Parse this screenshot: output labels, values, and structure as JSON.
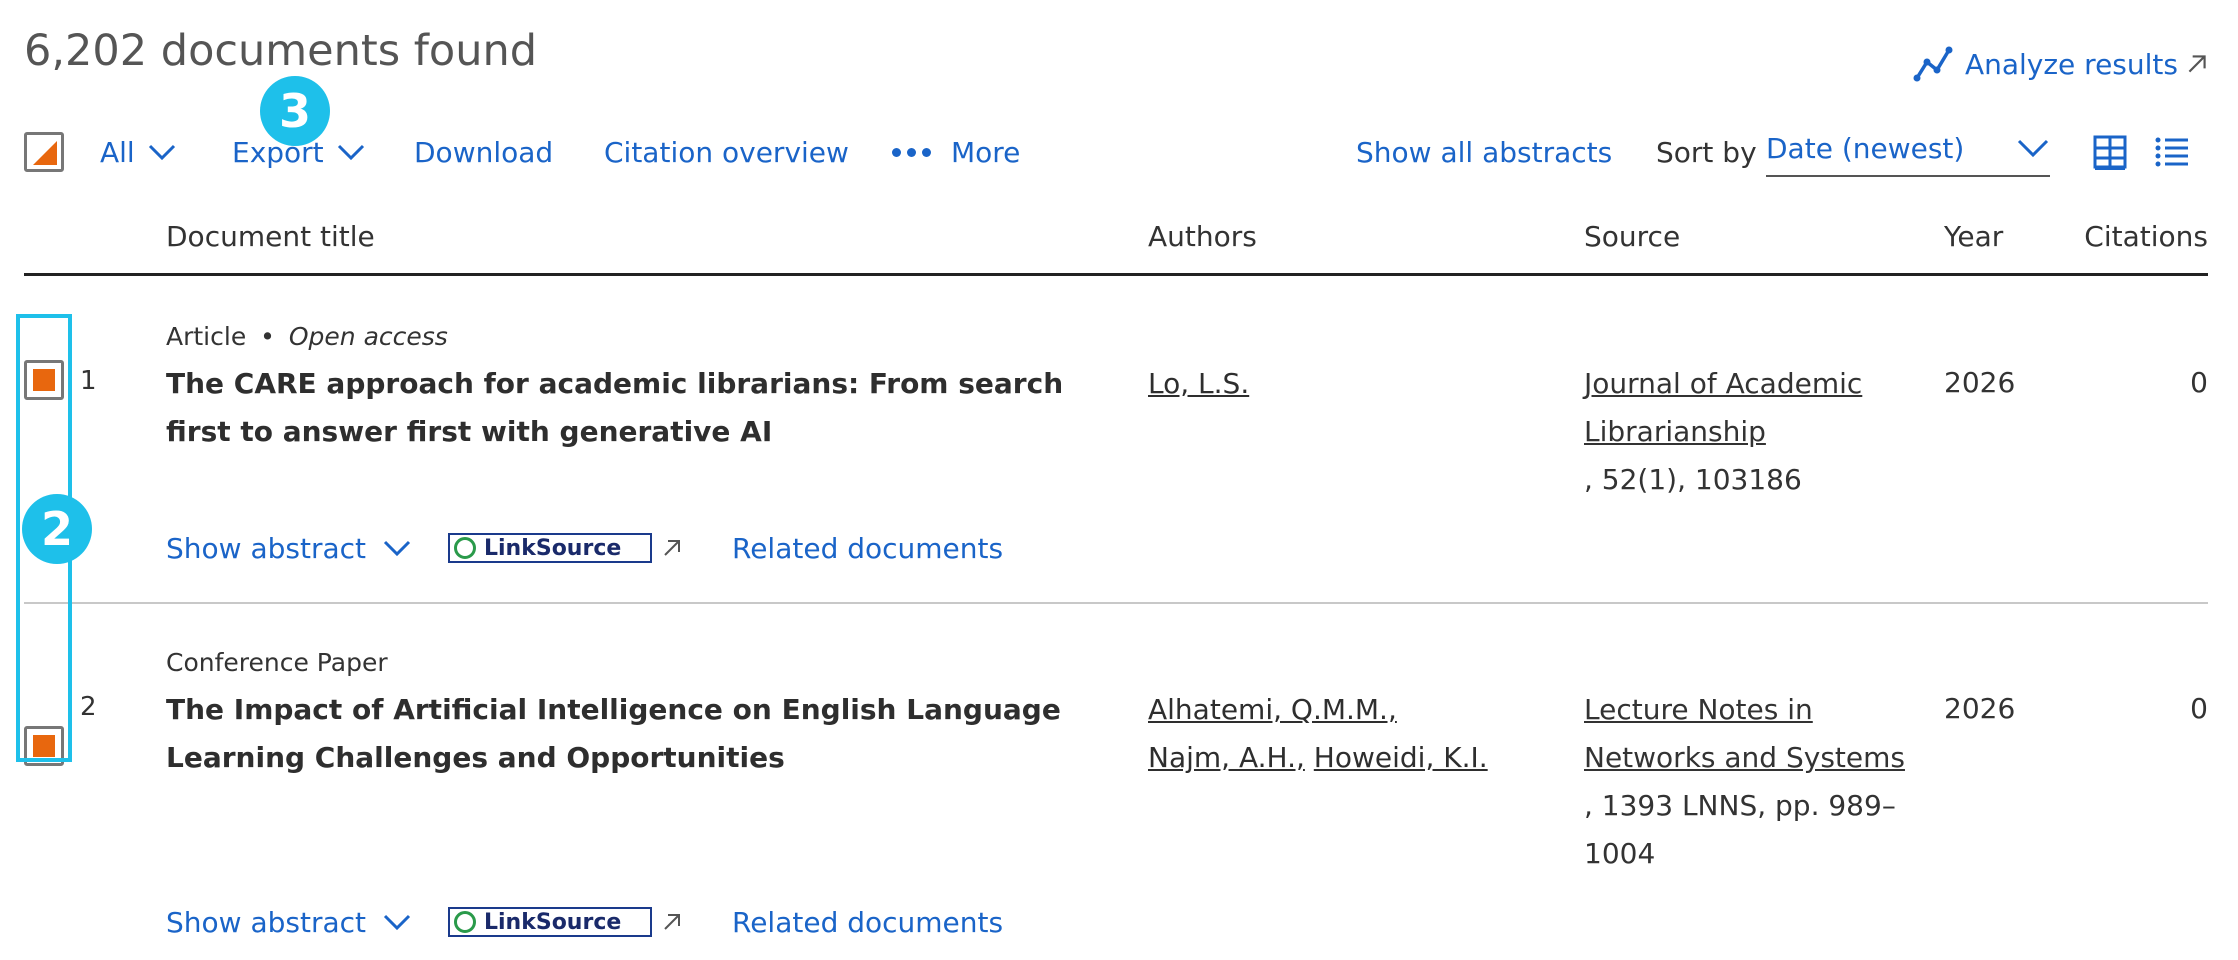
{
  "results": {
    "count_label": "6,202 documents found",
    "analyze_label": "Analyze results"
  },
  "toolbar": {
    "all_label": "All",
    "export_label": "Export",
    "download_label": "Download",
    "citation_label": "Citation overview",
    "more_label": "More",
    "show_abstracts_label": "Show all abstracts",
    "sort_label": "Sort by",
    "sort_value": "Date (newest)"
  },
  "columns": {
    "title": "Document title",
    "authors": "Authors",
    "source": "Source",
    "year": "Year",
    "citations": "Citations"
  },
  "documents": [
    {
      "number": "1",
      "type": "Article",
      "access": "Open access",
      "title": "The CARE approach for academic librarians: From search first to answer first with generative AI",
      "authors": [
        "Lo, L.S."
      ],
      "source_name": "Journal of Academic Librarianship",
      "source_details": ", 52(1), 103186",
      "year": "2026",
      "citations": "0"
    },
    {
      "number": "2",
      "type": "Conference Paper",
      "access": "",
      "title": "The Impact of Artificial Intelligence on English Language Learning Challenges and Opportunities",
      "authors": [
        "Alhatemi, Q.M.M.,",
        "Najm, A.H.,",
        "Howeidi, K.I."
      ],
      "source_name": "Lecture Notes in Networks and Systems",
      "source_details": ", 1393 LNNS, pp. 989–1004",
      "year": "2026",
      "citations": "0"
    }
  ],
  "row_actions": {
    "show_abstract_label": "Show abstract",
    "linksource_label": "LinkSource",
    "related_label": "Related documents"
  },
  "annotations": {
    "badge_2": "2",
    "badge_3": "3"
  },
  "colors": {
    "link": "#1a64c8",
    "checkbox_accent": "#e8670e",
    "annotation": "#1ec0ea"
  }
}
